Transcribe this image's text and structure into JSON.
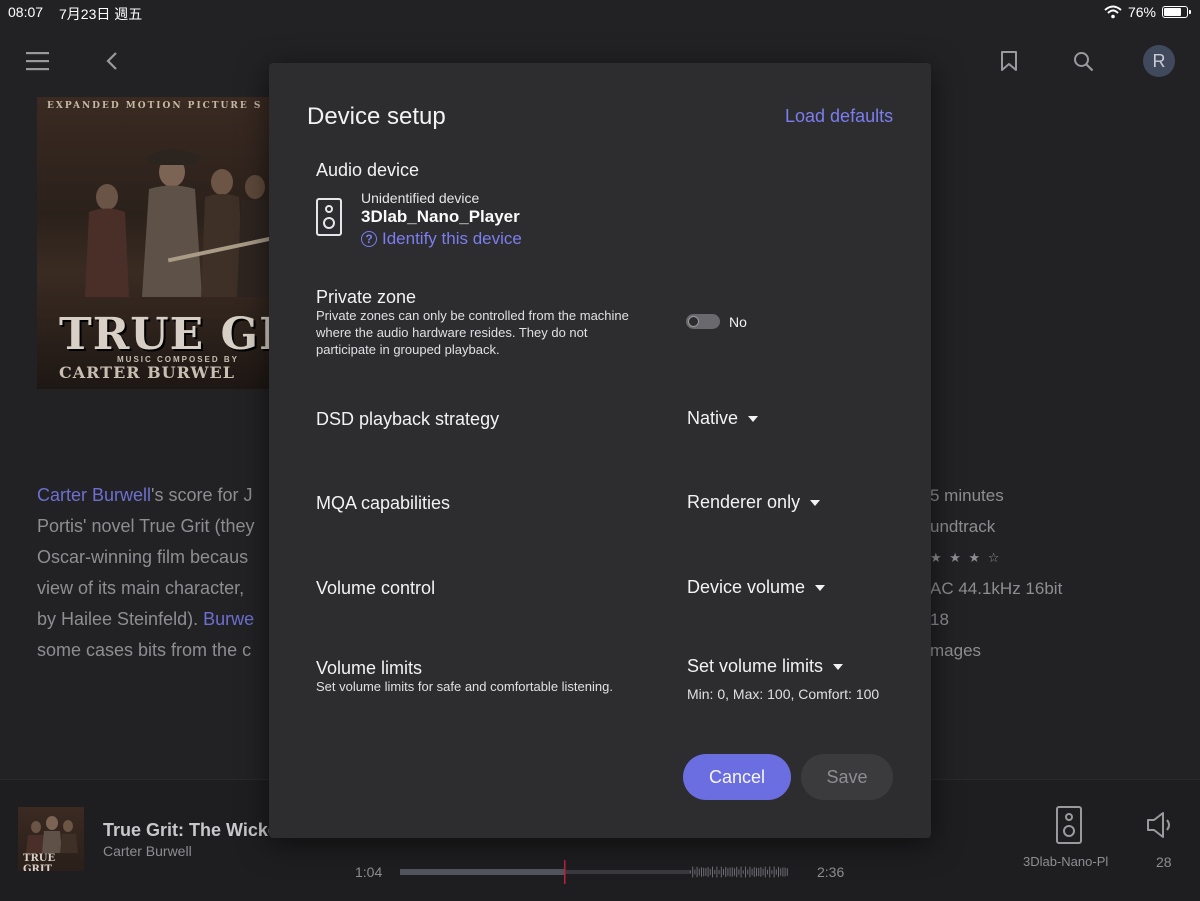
{
  "status_bar": {
    "time": "08:07",
    "date": "7月23日 週五",
    "battery": "76%"
  },
  "toolbar": {
    "avatar_letter": "R"
  },
  "cover": {
    "top_text": "EXPANDED MOTION PICTURE S",
    "title": "TRUE GRI",
    "composed_by": "MUSIC COMPOSED BY",
    "composer": "CARTER BURWEL"
  },
  "background": {
    "lines": [
      {
        "link": "Carter Burwell",
        "text": "'s score for J"
      },
      {
        "text": "Portis' novel True Grit (they"
      },
      {
        "text": "Oscar-winning film becaus"
      },
      {
        "text": "view of its main character,"
      },
      {
        "pre": "by Hailee Steinfeld). ",
        "link": "Burwe"
      },
      {
        "text": "some cases bits from  the c"
      }
    ],
    "info": [
      "5 minutes",
      "undtrack",
      "★ ★ ★ ☆",
      "AC 44.1kHz 16bit",
      "18",
      "mages"
    ]
  },
  "player": {
    "title": "True Grit: The Wicke",
    "artist": "Carter Burwell",
    "current_time": "1:04",
    "duration": "2:36",
    "device": "3Dlab-Nano-Pl",
    "volume": "28"
  },
  "modal": {
    "title": "Device setup",
    "load_defaults": "Load defaults",
    "audio_device": {
      "label": "Audio device",
      "status": "Unidentified device",
      "name": "3Dlab_Nano_Player",
      "identify": "Identify this device"
    },
    "private_zone": {
      "label": "Private zone",
      "description_lines": [
        "Private zones can only be controlled from the machine",
        "where the audio hardware resides. They do not",
        "participate in grouped playback."
      ],
      "toggle_label": "No"
    },
    "dsd": {
      "label": "DSD playback strategy",
      "value": "Native"
    },
    "mqa": {
      "label": "MQA capabilities",
      "value": "Renderer only"
    },
    "volume_control": {
      "label": "Volume control",
      "value": "Device volume"
    },
    "volume_limits": {
      "label": "Volume limits",
      "description": "Set volume limits for safe and comfortable listening.",
      "value": "Set volume limits",
      "summary": "Min: 0, Max: 100, Comfort: 100"
    },
    "cancel": "Cancel",
    "save": "Save"
  },
  "colors": {
    "accent": "#7b7df0",
    "button": "#6b6ee0",
    "modal_bg": "#2d2d2f",
    "page_bg": "#222224"
  }
}
